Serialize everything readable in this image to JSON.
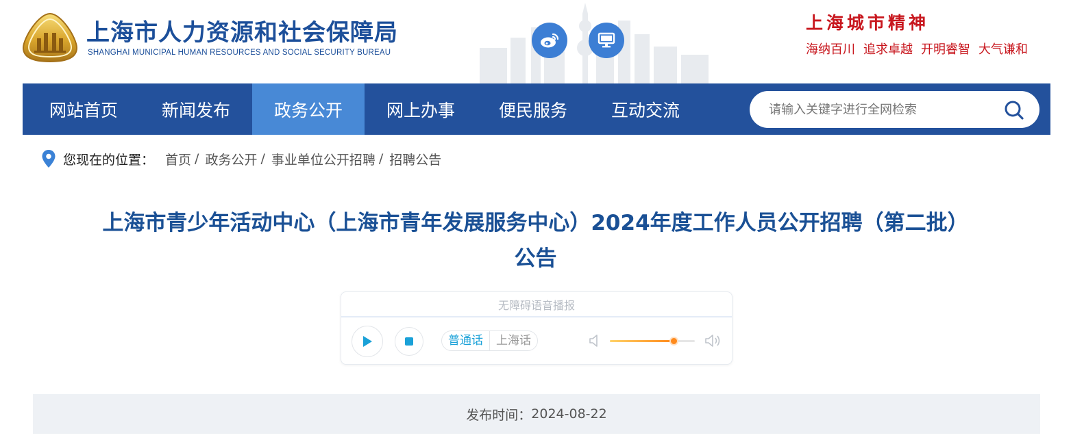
{
  "header": {
    "org_name": "上海市人力资源和社会保障局",
    "org_name_en": "SHANGHAI MUNICIPAL HUMAN RESOURCES AND SOCIAL SECURITY BUREAU",
    "spirit_title": "上海城市精神",
    "spirit_words": [
      "海纳百川",
      "追求卓越",
      "开明睿智",
      "大气谦和"
    ],
    "icons": [
      "weibo-icon",
      "screen-icon"
    ],
    "colors": {
      "brand_blue": "#1c4f9a",
      "spirit_red": "#c8171e"
    }
  },
  "nav": {
    "items": [
      {
        "label": "网站首页",
        "active": false
      },
      {
        "label": "新闻发布",
        "active": false
      },
      {
        "label": "政务公开",
        "active": true
      },
      {
        "label": "网上办事",
        "active": false
      },
      {
        "label": "便民服务",
        "active": false
      },
      {
        "label": "互动交流",
        "active": false
      }
    ],
    "search_placeholder": "请输入关键字进行全网检索",
    "colors": {
      "bar": "#23519c",
      "active": "#4889d6"
    }
  },
  "breadcrumb": {
    "label": "您现在的位置：",
    "items": [
      "首页",
      "政务公开",
      "事业单位公开招聘",
      "招聘公告"
    ],
    "separator": "/"
  },
  "article": {
    "title_line1": "上海市青少年活动中心（上海市青年发展服务中心）2024年度工作人员公开招聘（第二批）",
    "title_line2": "公告",
    "publish_label": "发布时间：",
    "publish_date": "2024-08-22"
  },
  "player": {
    "label": "无障碍语音播报",
    "dialects": [
      "普通话",
      "上海话"
    ],
    "selected_dialect": "普通话",
    "volume": 0.75
  }
}
